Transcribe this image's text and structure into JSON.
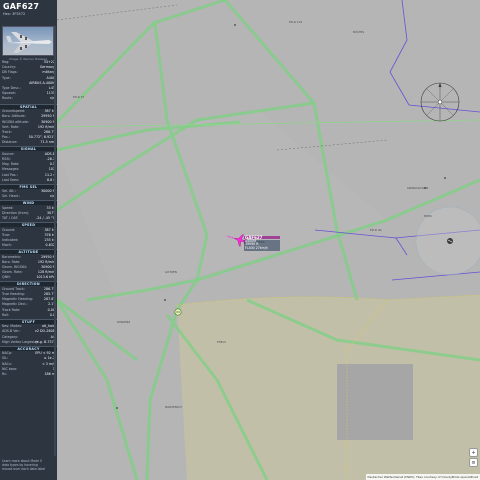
{
  "aircraft": {
    "callsign": "GAF627",
    "hex_line": "Hex: 3F5572",
    "photo_caption": "Image © Werner Hellweg",
    "map_label": [
      "GAF627",
      "A400M",
      "39990 ft",
      "FL400 27km/h",
      "GAF627"
    ]
  },
  "info_rows": [
    {
      "k": "Reg:",
      "v": "54+22"
    },
    {
      "k": "Country:",
      "v": "Germany"
    },
    {
      "k": "DB Flags:",
      "v": "military"
    },
    {
      "k": "Type:",
      "v": "A400"
    },
    {
      "k": "",
      "v": "AIRBUS A-400M"
    },
    {
      "k": "Type Desc.:",
      "v": "L4T"
    },
    {
      "k": "Squawk:",
      "v": "1135"
    },
    {
      "k": "Route:",
      "v": "n/a"
    }
  ],
  "sections": [
    {
      "title": "SPATIAL",
      "rows": [
        {
          "k": "Groundspeed:",
          "v": "387 kt"
        },
        {
          "k": "Baro. Altitude:",
          "v": "29950 ft"
        },
        {
          "k": "WGS84 altitude:",
          "v": "30900 ft"
        },
        {
          "k": "Vert. Rate:",
          "v": "192 ft/min"
        },
        {
          "k": "Track:",
          "v": "286.7°"
        },
        {
          "k": "Pos.:",
          "v": "50.772°, 6.921°"
        },
        {
          "k": "Distance:",
          "v": "71.5 nmi"
        }
      ]
    },
    {
      "title": "SIGNAL",
      "rows": [
        {
          "k": "Source:",
          "v": "ADS-B"
        },
        {
          "k": "RSSI:",
          "v": "-26.7"
        },
        {
          "k": "Msg. Rate:",
          "v": "0.5"
        },
        {
          "k": "Messages:",
          "v": "107"
        },
        {
          "k": "Last Pos.:",
          "v": "11.2 s"
        },
        {
          "k": "Last Seen:",
          "v": "6.6 s"
        }
      ]
    },
    {
      "title": "FMS SEL",
      "rows": [
        {
          "k": "Sel. Alt.:",
          "v": "30000 ft"
        },
        {
          "k": "Sel. Head.:",
          "v": "n/a"
        }
      ]
    },
    {
      "title": "WIND",
      "rows": [
        {
          "k": "Speed:",
          "v": "33 kt"
        },
        {
          "k": "Direction (from):",
          "v": "307°"
        },
        {
          "k": "TAT / OAT:",
          "v": "-24 / -45 °C"
        }
      ]
    },
    {
      "title": "SPEED",
      "rows": [
        {
          "k": "Ground:",
          "v": "387 kt"
        },
        {
          "k": "True:",
          "v": "376 kt"
        },
        {
          "k": "Indicated:",
          "v": "235 kt"
        },
        {
          "k": "Mach:",
          "v": "0.632"
        }
      ]
    },
    {
      "title": "ALTITUDE",
      "rows": [
        {
          "k": "Barometric:",
          "v": "29950 ft"
        },
        {
          "k": "Baro. Rate:",
          "v": "192 ft/min"
        },
        {
          "k": "Geom. WGS84:",
          "v": "30900 ft"
        },
        {
          "k": "Geom. Rate:",
          "v": "128 ft/min"
        },
        {
          "k": "QNH:",
          "v": "1013.6 hPa"
        }
      ]
    },
    {
      "title": "DIRECTION",
      "rows": [
        {
          "k": "Ground Track:",
          "v": "286.7°"
        },
        {
          "k": "True Heading:",
          "v": "285.7°"
        },
        {
          "k": "Magnetic Heading:",
          "v": "287.8°"
        },
        {
          "k": "Magnetic Decl.:",
          "v": "2.1°"
        },
        {
          "k": "Track Rate:",
          "v": "0.00"
        },
        {
          "k": "Roll:",
          "v": "0.0"
        }
      ]
    },
    {
      "title": "STUFF",
      "rows": [
        {
          "k": "Nav. Modes:",
          "v": "alt_hold"
        },
        {
          "k": "ADS-B Ver.:",
          "v": "v2 DO-260B"
        },
        {
          "k": "Category:",
          "v": "A4"
        },
        {
          "k": "High Vortex Largesize",
          "v": "(e.g. B-757)"
        }
      ]
    },
    {
      "title": "ACCURACY",
      "rows": [
        {
          "k": "NACp:",
          "v": "EPU < 92 m"
        },
        {
          "k": "SIL:",
          "v": "≤ 1e-7"
        },
        {
          "k": "NACv:",
          "v": "< 3 m/s"
        },
        {
          "k": "NIC baro:",
          "v": "1"
        },
        {
          "k": "Rc:",
          "v": "186 m"
        }
      ]
    }
  ],
  "footer": "Learn more about Mode S data types by hovering mouse over each data label",
  "map": {
    "attribution": "Deutscher Wetterdienst (DWD): Tiles courtesy of CloudyBirds openAIP.net",
    "small_labels": [
      "ED-R 119",
      "ED-R 97",
      "GÖTZEN",
      "BÜCHEL",
      "NORVENICH",
      "SPANGDAHLEM",
      "EDDK",
      "EDRK",
      "KOBLENZ",
      "EHELS",
      "ED-D 9A"
    ]
  }
}
